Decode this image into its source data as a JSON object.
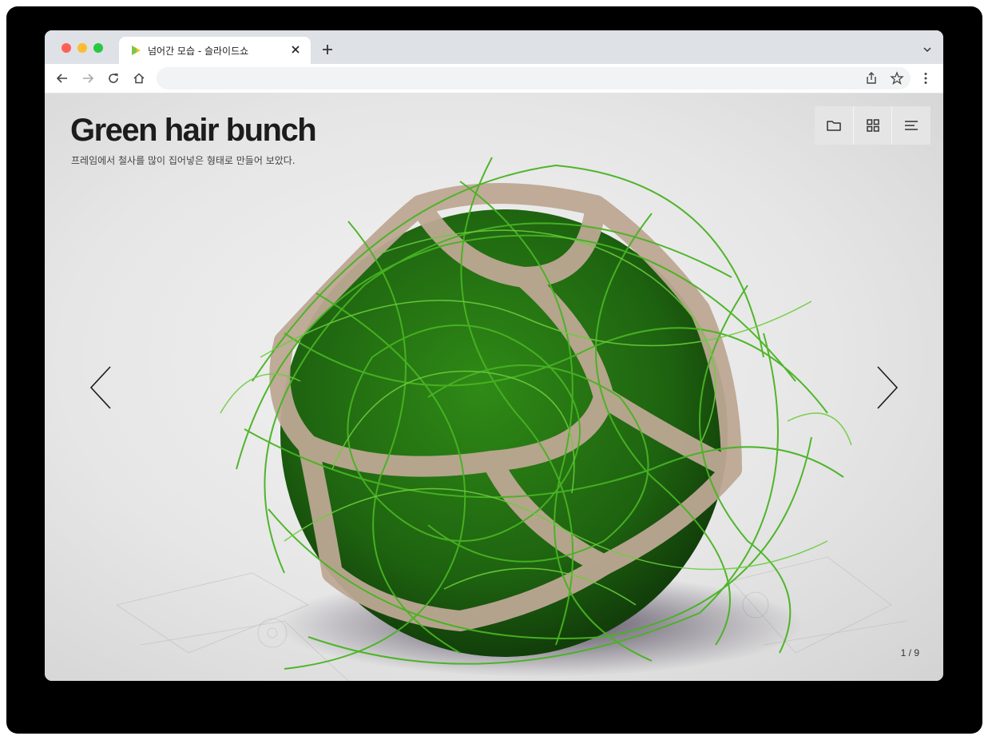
{
  "browser": {
    "tab": {
      "title": "넘어간 모습 - 슬라이드쇼",
      "favicon": "play-triangle-icon"
    },
    "toolbar": {
      "address_value": "",
      "icons": [
        "back-arrow-icon",
        "forward-arrow-icon",
        "reload-icon",
        "home-icon",
        "share-icon",
        "bookmark-star-icon",
        "kebab-menu-icon"
      ]
    }
  },
  "slide": {
    "title": "Green hair bunch",
    "subtitle": "프레임에서 철사를 많이 집어넣은 형태로 만들어 보았다.",
    "counter": "1 / 9",
    "image_subject": "green-wire-ball-in-frame"
  },
  "view_controls": {
    "icons": [
      "folder-icon",
      "grid-icon",
      "list-menu-icon"
    ]
  },
  "colors": {
    "title": "#1c1c1c",
    "wire_green": "#3aa01c",
    "frame_tan": "#b8a48e",
    "traffic_red": "#ff5f57",
    "traffic_yellow": "#febc2e",
    "traffic_green": "#28c840"
  }
}
